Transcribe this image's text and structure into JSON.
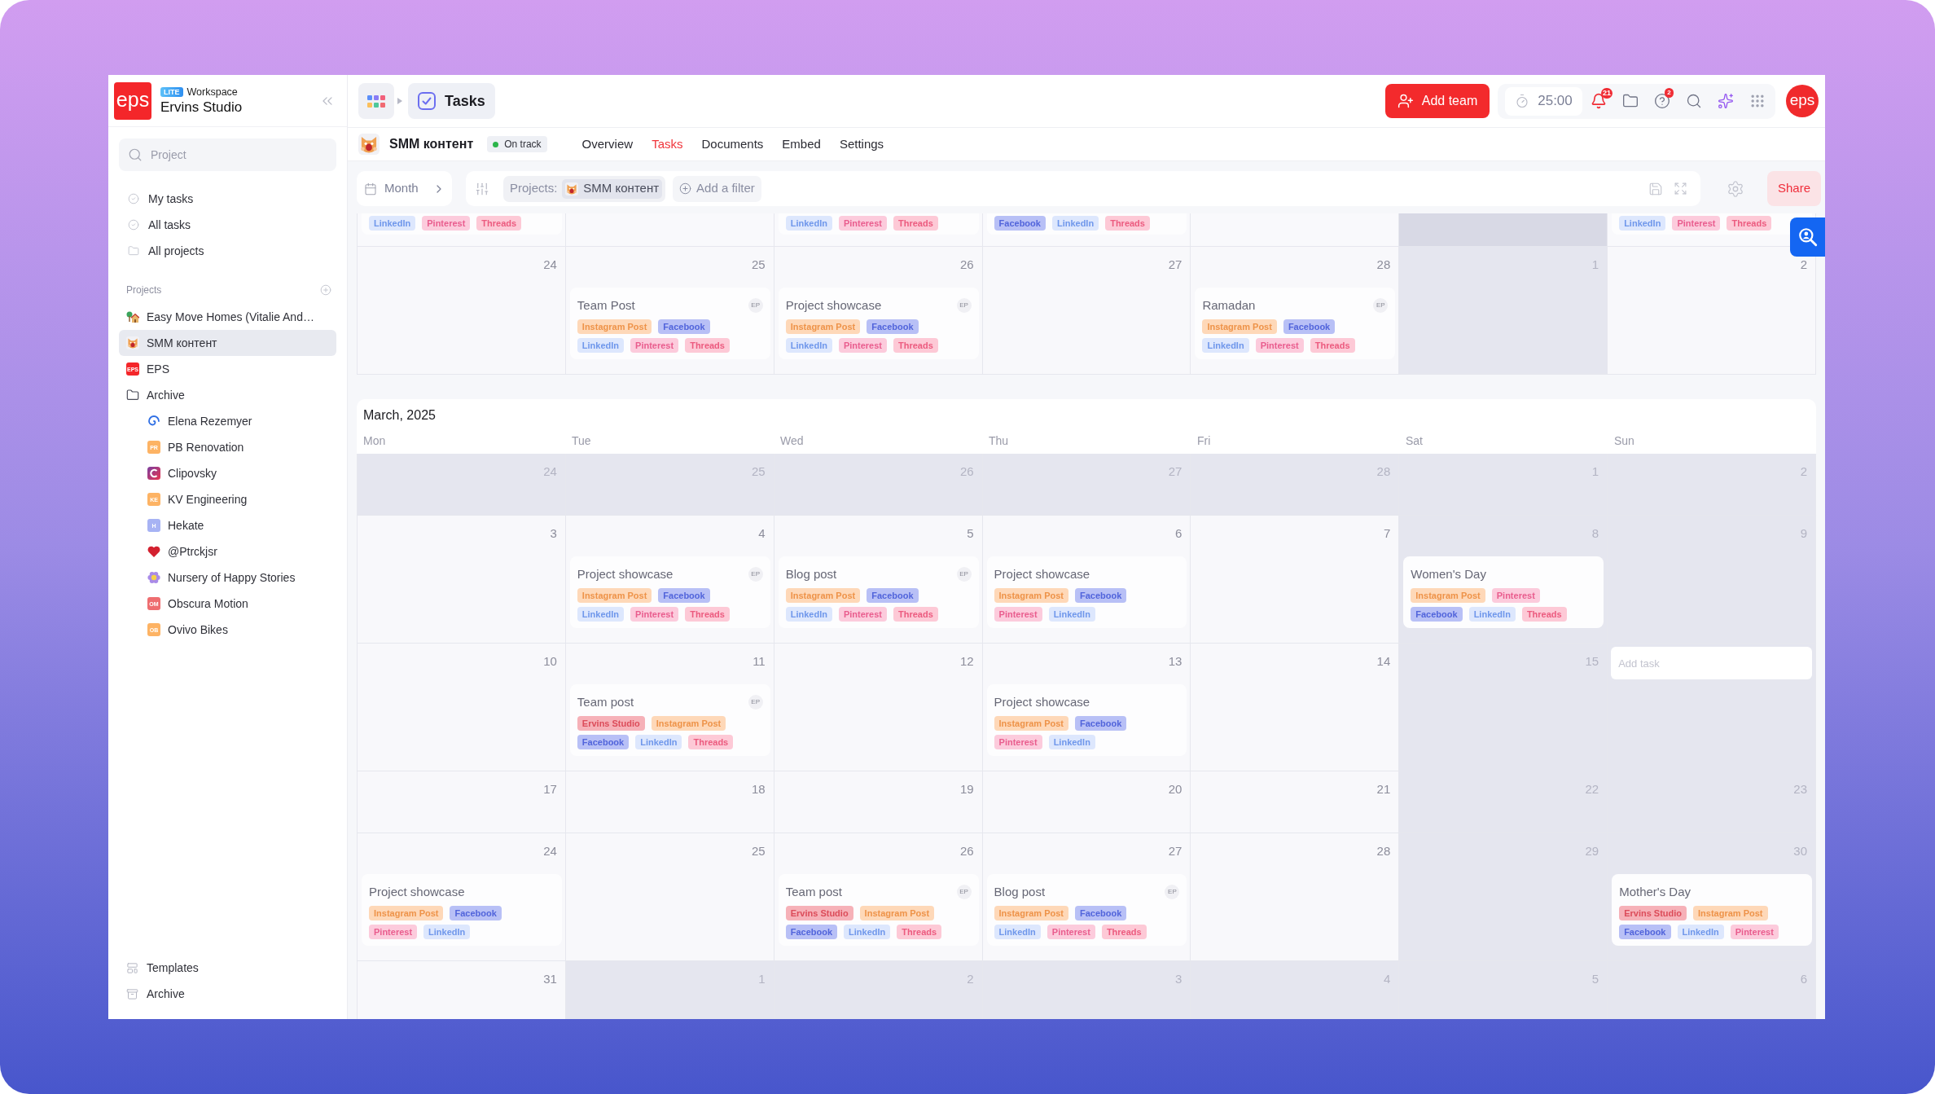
{
  "sidebar": {
    "logo": "eps",
    "plan_badge": "LITE",
    "workspace_label": "Workspace",
    "workspace_name": "Ervins Studio",
    "search": {
      "placeholder": "Project"
    },
    "nav": [
      {
        "label": "My tasks",
        "selected": false
      },
      {
        "label": "All tasks",
        "selected": false
      },
      {
        "label": "All projects",
        "selected": false
      }
    ],
    "projects_heading": "Projects",
    "projects": [
      {
        "kind": "picture",
        "label": "Easy Move Homes (Vitalie And…",
        "selected": false
      },
      {
        "kind": "picture",
        "label": "SMM контент",
        "selected": true
      },
      {
        "kind": "initials",
        "initials": "EPS",
        "color": "#f4262a",
        "label": "EPS",
        "selected": false
      },
      {
        "kind": "folder",
        "label": "Archive",
        "selected": false,
        "children": [
          {
            "kind": "picture",
            "label": "Elena Rezemyer",
            "selected": false
          },
          {
            "kind": "initials",
            "initials": "PR",
            "color": "#fdb364",
            "label": "PB Renovation",
            "selected": false
          },
          {
            "kind": "picture",
            "label": "Clipovsky",
            "selected": false
          },
          {
            "kind": "initials",
            "initials": "KE",
            "color": "#fdb364",
            "label": "KV Engineering",
            "selected": false
          },
          {
            "kind": "initials",
            "initials": "H",
            "color": "#a7b3f4",
            "label": "Hekate",
            "selected": false
          },
          {
            "kind": "picture",
            "label": "@Ptrckjsr",
            "selected": false
          },
          {
            "kind": "picture",
            "label": "Nursery of Happy Stories",
            "selected": false
          },
          {
            "kind": "initials",
            "initials": "OM",
            "color": "#ee6d70",
            "label": "Obscura Motion",
            "selected": false
          },
          {
            "kind": "initials",
            "initials": "OB",
            "color": "#fdb364",
            "label": "Ovivo Bikes",
            "selected": false
          }
        ]
      }
    ],
    "footer": [
      {
        "label": "Templates"
      },
      {
        "label": "Archive"
      }
    ]
  },
  "topbar": {
    "breadcrumb": "Tasks",
    "add_team": "Add team",
    "timer": "25:00",
    "notification_count": "21",
    "help_count": "2",
    "avatar": "eps"
  },
  "project_bar": {
    "name": "SMM контент",
    "status": "On track",
    "tabs": [
      {
        "label": "Overview",
        "selected": false
      },
      {
        "label": "Tasks",
        "selected": true
      },
      {
        "label": "Documents",
        "selected": false
      },
      {
        "label": "Embed",
        "selected": false
      },
      {
        "label": "Settings",
        "selected": false
      }
    ]
  },
  "filter_bar": {
    "view": "Month",
    "filter_label": "Projects:",
    "filter_value": "SMM контент",
    "add_filter": "Add a filter",
    "share": "Share"
  },
  "calendar": {
    "sections": [
      {
        "weeks": [
          {
            "kind": "partial",
            "cells": [
              {
                "muted": false,
                "tags": [
                  {
                    "label": "LinkedIn",
                    "color": "#dde7fd"
                  },
                  {
                    "label": "Pinterest",
                    "color": "#fccbdc"
                  },
                  {
                    "label": "Threads",
                    "color": "#fdc9d6"
                  }
                ]
              },
              {
                "muted": false
              },
              {
                "muted": false,
                "tags": [
                  {
                    "label": "LinkedIn",
                    "color": "#dde7fd"
                  },
                  {
                    "label": "Pinterest",
                    "color": "#fccbdc"
                  },
                  {
                    "label": "Threads",
                    "color": "#fdc9d6"
                  }
                ]
              },
              {
                "muted": false,
                "tags": [
                  {
                    "label": "Facebook",
                    "color": "#b8c0f6"
                  },
                  {
                    "label": "LinkedIn",
                    "color": "#dde7fd"
                  },
                  {
                    "label": "Threads",
                    "color": "#fdc9d6"
                  }
                ]
              },
              {
                "muted": false
              },
              {
                "muted": true
              },
              {
                "muted": false,
                "tags": [
                  {
                    "label": "LinkedIn",
                    "color": "#dde7fd"
                  },
                  {
                    "label": "Pinterest",
                    "color": "#fccbdc"
                  },
                  {
                    "label": "Threads",
                    "color": "#fdc9d6"
                  }
                ]
              }
            ]
          },
          {
            "kind": "full",
            "cells": [
              {
                "day": "24",
                "muted": false
              },
              {
                "day": "25",
                "muted": false,
                "tasks": [
                  {
                    "title": "Team Post",
                    "assignee": "EP",
                    "tag_rows": [
                      [
                        {
                          "label": "Instagram Post",
                          "color": "#fed8b8"
                        },
                        {
                          "label": "Facebook",
                          "color": "#b8c0f6"
                        }
                      ],
                      [
                        {
                          "label": "LinkedIn",
                          "color": "#dde7fd"
                        },
                        {
                          "label": "Pinterest",
                          "color": "#fccbdc"
                        },
                        {
                          "label": "Threads",
                          "color": "#fdc9d6"
                        }
                      ]
                    ]
                  }
                ]
              },
              {
                "day": "26",
                "muted": false,
                "tasks": [
                  {
                    "title": "Project showcase",
                    "assignee": "EP",
                    "tag_rows": [
                      [
                        {
                          "label": "Instagram Post",
                          "color": "#fed8b8"
                        },
                        {
                          "label": "Facebook",
                          "color": "#b8c0f6"
                        }
                      ],
                      [
                        {
                          "label": "LinkedIn",
                          "color": "#dde7fd"
                        },
                        {
                          "label": "Pinterest",
                          "color": "#fccbdc"
                        },
                        {
                          "label": "Threads",
                          "color": "#fdc9d6"
                        }
                      ]
                    ]
                  }
                ]
              },
              {
                "day": "27",
                "muted": false
              },
              {
                "day": "28",
                "muted": false,
                "tasks": [
                  {
                    "title": "Ramadan",
                    "assignee": "EP",
                    "tag_rows": [
                      [
                        {
                          "label": "Instagram Post",
                          "color": "#fed8b8"
                        },
                        {
                          "label": "Facebook",
                          "color": "#b8c0f6"
                        }
                      ],
                      [
                        {
                          "label": "LinkedIn",
                          "color": "#dde7fd"
                        },
                        {
                          "label": "Pinterest",
                          "color": "#fccbdc"
                        },
                        {
                          "label": "Threads",
                          "color": "#fdc9d6"
                        }
                      ]
                    ]
                  }
                ]
              },
              {
                "day": "1",
                "muted": true
              },
              {
                "day": "2",
                "muted": false
              }
            ]
          }
        ]
      },
      {
        "title": "March, 2025",
        "weekdays": [
          "Mon",
          "Tue",
          "Wed",
          "Thu",
          "Fri",
          "Sat",
          "Sun"
        ],
        "weeks": [
          {
            "kind": "full",
            "cells": [
              {
                "day": "24",
                "muted": true
              },
              {
                "day": "25",
                "muted": true
              },
              {
                "day": "26",
                "muted": true
              },
              {
                "day": "27",
                "muted": true
              },
              {
                "day": "28",
                "muted": true
              },
              {
                "day": "1",
                "muted": true
              },
              {
                "day": "2",
                "muted": true
              }
            ]
          },
          {
            "kind": "full",
            "cells": [
              {
                "day": "3",
                "muted": false
              },
              {
                "day": "4",
                "muted": false,
                "tasks": [
                  {
                    "title": "Project showcase",
                    "assignee": "EP",
                    "tag_rows": [
                      [
                        {
                          "label": "Instagram Post",
                          "color": "#fed8b8"
                        },
                        {
                          "label": "Facebook",
                          "color": "#b8c0f6"
                        }
                      ],
                      [
                        {
                          "label": "LinkedIn",
                          "color": "#dde7fd"
                        },
                        {
                          "label": "Pinterest",
                          "color": "#fccbdc"
                        },
                        {
                          "label": "Threads",
                          "color": "#fdc9d6"
                        }
                      ]
                    ]
                  }
                ]
              },
              {
                "day": "5",
                "muted": false,
                "tasks": [
                  {
                    "title": "Blog post",
                    "assignee": "EP",
                    "tag_rows": [
                      [
                        {
                          "label": "Instagram Post",
                          "color": "#fed8b8"
                        },
                        {
                          "label": "Facebook",
                          "color": "#b8c0f6"
                        }
                      ],
                      [
                        {
                          "label": "LinkedIn",
                          "color": "#dde7fd"
                        },
                        {
                          "label": "Pinterest",
                          "color": "#fccbdc"
                        },
                        {
                          "label": "Threads",
                          "color": "#fdc9d6"
                        }
                      ]
                    ]
                  }
                ]
              },
              {
                "day": "6",
                "muted": false,
                "tasks": [
                  {
                    "title": "Project showcase",
                    "tag_rows": [
                      [
                        {
                          "label": "Instagram Post",
                          "color": "#fed8b8"
                        },
                        {
                          "label": "Facebook",
                          "color": "#b8c0f6"
                        }
                      ],
                      [
                        {
                          "label": "Pinterest",
                          "color": "#fccbdc"
                        },
                        {
                          "label": "LinkedIn",
                          "color": "#dde7fd"
                        }
                      ]
                    ]
                  }
                ]
              },
              {
                "day": "7",
                "muted": false
              },
              {
                "day": "8",
                "muted": true,
                "tasks": [
                  {
                    "title": "Women's Day",
                    "tag_rows": [
                      [
                        {
                          "label": "Instagram Post",
                          "color": "#fed8b8"
                        },
                        {
                          "label": "Pinterest",
                          "color": "#fccbdc"
                        }
                      ],
                      [
                        {
                          "label": "Facebook",
                          "color": "#b8c0f6"
                        },
                        {
                          "label": "LinkedIn",
                          "color": "#dde7fd"
                        },
                        {
                          "label": "Threads",
                          "color": "#fdc9d6"
                        }
                      ]
                    ]
                  }
                ]
              },
              {
                "day": "9",
                "muted": true
              }
            ]
          },
          {
            "kind": "full",
            "cells": [
              {
                "day": "10",
                "muted": false
              },
              {
                "day": "11",
                "muted": false,
                "tasks": [
                  {
                    "title": "Team post",
                    "assignee": "EP",
                    "tag_rows": [
                      [
                        {
                          "label": "Ervins Studio",
                          "color": "#f6b1b8"
                        },
                        {
                          "label": "Instagram Post",
                          "color": "#fed8b8"
                        }
                      ],
                      [
                        {
                          "label": "Facebook",
                          "color": "#b8c0f6"
                        },
                        {
                          "label": "LinkedIn",
                          "color": "#dde7fd"
                        },
                        {
                          "label": "Threads",
                          "color": "#fdc9d6"
                        }
                      ]
                    ]
                  }
                ]
              },
              {
                "day": "12",
                "muted": false
              },
              {
                "day": "13",
                "muted": false,
                "tasks": [
                  {
                    "title": "Project showcase",
                    "tag_rows": [
                      [
                        {
                          "label": "Instagram Post",
                          "color": "#fed8b8"
                        },
                        {
                          "label": "Facebook",
                          "color": "#b8c0f6"
                        }
                      ],
                      [
                        {
                          "label": "Pinterest",
                          "color": "#fccbdc"
                        },
                        {
                          "label": "LinkedIn",
                          "color": "#dde7fd"
                        }
                      ]
                    ]
                  }
                ]
              },
              {
                "day": "14",
                "muted": false
              },
              {
                "day": "15",
                "muted": true
              },
              {
                "muted": true,
                "add_task": {
                  "placeholder": "Add task"
                }
              }
            ]
          },
          {
            "kind": "full",
            "cells": [
              {
                "day": "17",
                "muted": false
              },
              {
                "day": "18",
                "muted": false
              },
              {
                "day": "19",
                "muted": false
              },
              {
                "day": "20",
                "muted": false
              },
              {
                "day": "21",
                "muted": false
              },
              {
                "day": "22",
                "muted": true
              },
              {
                "day": "23",
                "muted": true
              }
            ]
          },
          {
            "kind": "full",
            "cells": [
              {
                "day": "24",
                "muted": false,
                "tasks": [
                  {
                    "title": "Project showcase",
                    "tag_rows": [
                      [
                        {
                          "label": "Instagram Post",
                          "color": "#fed8b8"
                        },
                        {
                          "label": "Facebook",
                          "color": "#b8c0f6"
                        }
                      ],
                      [
                        {
                          "label": "Pinterest",
                          "color": "#fccbdc"
                        },
                        {
                          "label": "LinkedIn",
                          "color": "#dde7fd"
                        }
                      ]
                    ]
                  }
                ]
              },
              {
                "day": "25",
                "muted": false
              },
              {
                "day": "26",
                "muted": false,
                "tasks": [
                  {
                    "title": "Team post",
                    "assignee": "EP",
                    "tag_rows": [
                      [
                        {
                          "label": "Ervins Studio",
                          "color": "#f6b1b8"
                        },
                        {
                          "label": "Instagram Post",
                          "color": "#fed8b8"
                        }
                      ],
                      [
                        {
                          "label": "Facebook",
                          "color": "#b8c0f6"
                        },
                        {
                          "label": "LinkedIn",
                          "color": "#dde7fd"
                        },
                        {
                          "label": "Threads",
                          "color": "#fdc9d6"
                        }
                      ]
                    ]
                  }
                ]
              },
              {
                "day": "27",
                "muted": false,
                "tasks": [
                  {
                    "title": "Blog post",
                    "assignee": "EP",
                    "tag_rows": [
                      [
                        {
                          "label": "Instagram Post",
                          "color": "#fed8b8"
                        },
                        {
                          "label": "Facebook",
                          "color": "#b8c0f6"
                        }
                      ],
                      [
                        {
                          "label": "LinkedIn",
                          "color": "#dde7fd"
                        },
                        {
                          "label": "Pinterest",
                          "color": "#fccbdc"
                        },
                        {
                          "label": "Threads",
                          "color": "#fdc9d6"
                        }
                      ]
                    ]
                  }
                ]
              },
              {
                "day": "28",
                "muted": false
              },
              {
                "day": "29",
                "muted": true
              },
              {
                "day": "30",
                "muted": true,
                "tasks": [
                  {
                    "title": "Mother's Day",
                    "tag_rows": [
                      [
                        {
                          "label": "Ervins Studio",
                          "color": "#f6b1b8"
                        },
                        {
                          "label": "Instagram Post",
                          "color": "#fed8b8"
                        }
                      ],
                      [
                        {
                          "label": "Facebook",
                          "color": "#b8c0f6"
                        },
                        {
                          "label": "LinkedIn",
                          "color": "#dde7fd"
                        },
                        {
                          "label": "Pinterest",
                          "color": "#fccbdc"
                        }
                      ]
                    ]
                  }
                ]
              }
            ]
          },
          {
            "kind": "full",
            "cells": [
              {
                "day": "31",
                "muted": false
              },
              {
                "day": "1",
                "muted": true
              },
              {
                "day": "2",
                "muted": true
              },
              {
                "day": "3",
                "muted": true
              },
              {
                "day": "4",
                "muted": true
              },
              {
                "day": "5",
                "muted": true
              },
              {
                "day": "6",
                "muted": true
              }
            ]
          }
        ]
      }
    ]
  }
}
